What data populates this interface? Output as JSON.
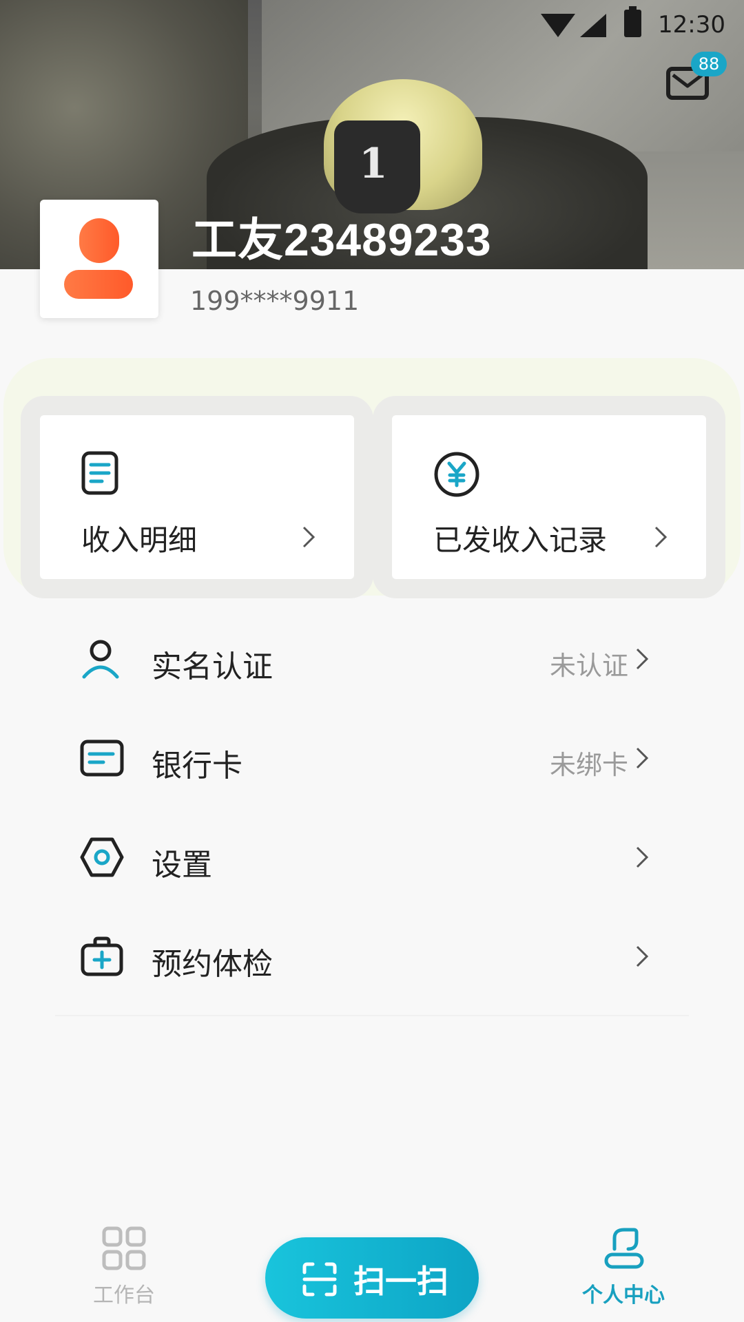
{
  "status_bar": {
    "time": "12:30"
  },
  "header": {
    "unread_count": "88",
    "helmet_number": "1"
  },
  "profile": {
    "name": "工友23489233",
    "phone": "199****9911"
  },
  "quick_cards": [
    {
      "label": "收入明细",
      "icon": "document-icon"
    },
    {
      "label": "已发收入记录",
      "icon": "yuan-coin-icon"
    }
  ],
  "menu": [
    {
      "label": "实名认证",
      "status": "未认证",
      "icon": "user-icon"
    },
    {
      "label": "银行卡",
      "status": "未绑卡",
      "icon": "bank-card-icon"
    },
    {
      "label": "设置",
      "status": "",
      "icon": "settings-icon"
    },
    {
      "label": "预约体检",
      "status": "",
      "icon": "medical-kit-icon"
    }
  ],
  "bottom_nav": {
    "workbench": "工作台",
    "scan": "扫一扫",
    "profile": "个人中心",
    "active": "个人中心"
  },
  "colors": {
    "accent": "#1aa6c7",
    "avatar": "#ff6a35",
    "text": "#222222",
    "muted": "#9a9a9a"
  }
}
